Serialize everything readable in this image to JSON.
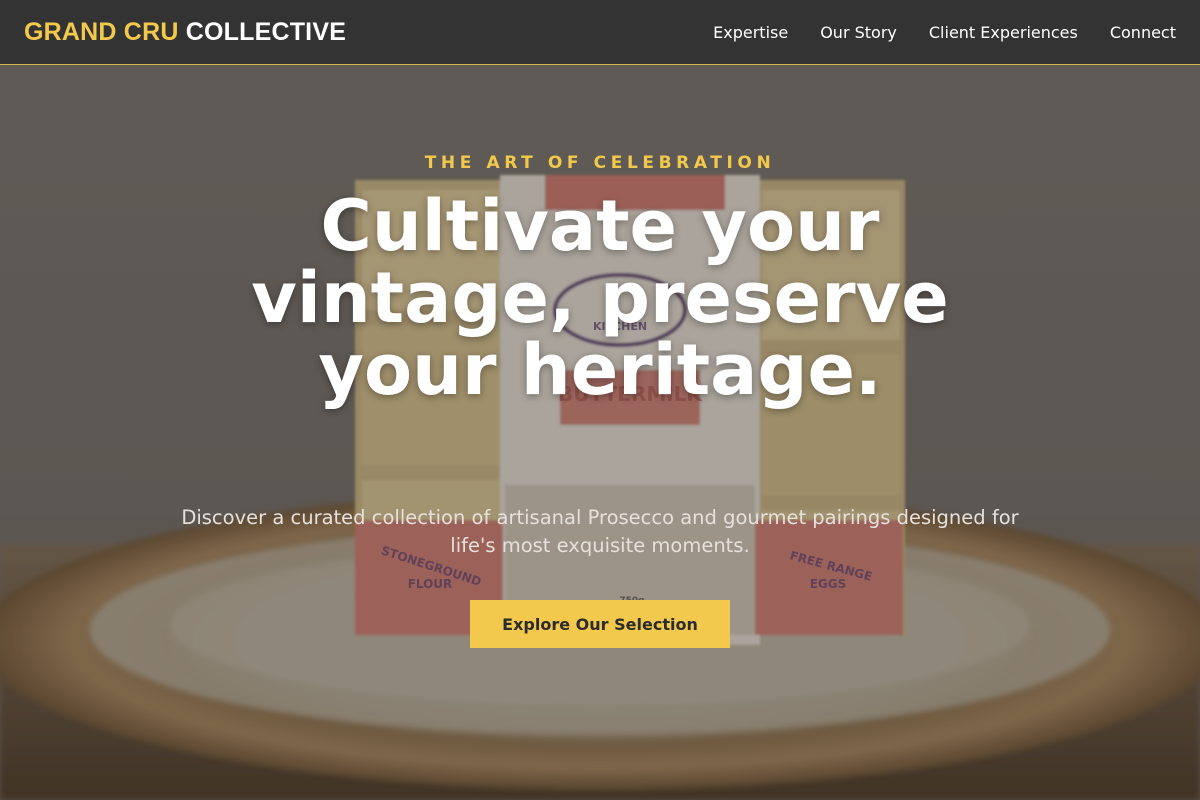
{
  "brand": {
    "accent_part": "GRAND CRU",
    "rest_part": "COLLECTIVE"
  },
  "nav": {
    "links": [
      {
        "label": "Expertise"
      },
      {
        "label": "Our Story"
      },
      {
        "label": "Client Experiences"
      },
      {
        "label": "Connect"
      }
    ]
  },
  "hero": {
    "eyebrow": "THE ART OF CELEBRATION",
    "headline": "Cultivate your vintage, preserve your heritage.",
    "subtitle": "Discover a curated collection of artisanal Prosecco and gourmet pairings designed for life's most exquisite moments.",
    "cta_label": "Explore Our Selection"
  },
  "photo_labels": {
    "left_badge": [
      "STONEGROUND",
      "FLOUR"
    ],
    "right_badge": [
      "FREE RANGE",
      "EGGS"
    ],
    "brand_label": "KITCHEN",
    "product_label": "BUTTERMILK",
    "weight": "750g"
  },
  "colors": {
    "accent": "#f2c94c",
    "navbar_bg": "#333333",
    "nav_border": "#d4b84a",
    "cta_text": "#2b2b2b"
  }
}
